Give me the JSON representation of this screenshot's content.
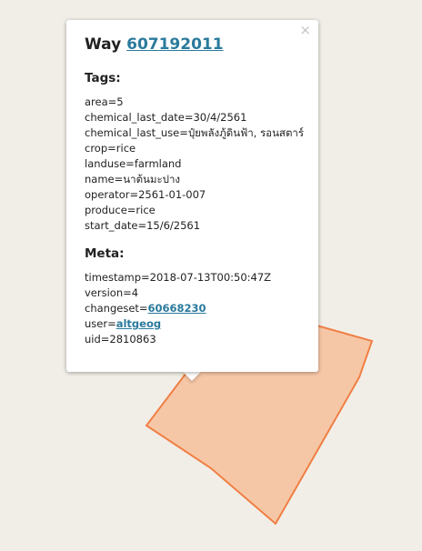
{
  "popup": {
    "title_prefix": "Way",
    "way_id": "607192011",
    "close_icon": "×",
    "tags_heading": "Tags:",
    "tags": [
      "area=5",
      "chemical_last_date=30/4/2561",
      "chemical_last_use=ปุ๋ยพลังภู้ดินฟ้า, รอนสตาร์",
      "crop=rice",
      "landuse=farmland",
      "name=นาต้นมะปาง",
      "operator=2561-01-007",
      "produce=rice",
      "start_date=15/6/2561"
    ],
    "meta_heading": "Meta:",
    "meta": {
      "timestamp": "timestamp=2018-07-13T00:50:47Z",
      "version": "version=4",
      "changeset_label": "changeset=",
      "changeset_value": "60668230",
      "user_label": "user=",
      "user_value": "altgeog",
      "uid": "uid=2810863"
    }
  },
  "colors": {
    "background": "#f1eee8",
    "polygon_fill": "#f5c4a2",
    "polygon_stroke": "#f07f44",
    "link": "#2a7a9c",
    "road_casing": "#f5d979"
  }
}
